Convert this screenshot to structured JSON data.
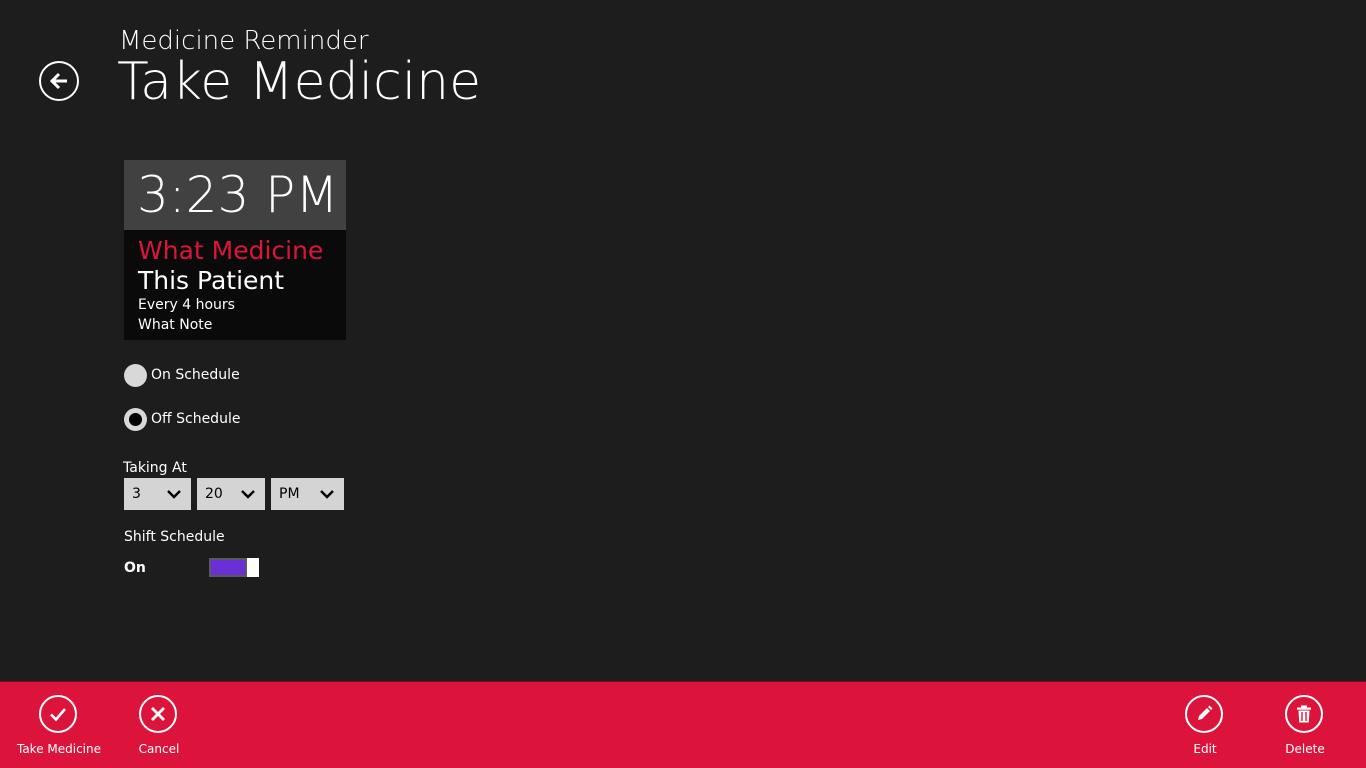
{
  "header": {
    "app_name": "Medicine Reminder",
    "page_title": "Take Medicine",
    "back_icon": "back-arrow-icon"
  },
  "card": {
    "time": "3:23 PM",
    "medicine": "What Medicine",
    "patient": "This Patient",
    "frequency": "Every 4 hours",
    "note": "What Note",
    "medicine_color": "#dc143c"
  },
  "schedule_options": {
    "on_label": "On Schedule",
    "off_label": "Off Schedule",
    "selected": "Off Schedule"
  },
  "taking_at": {
    "label": "Taking At",
    "hour": "3",
    "minute": "20",
    "period": "PM"
  },
  "shift_schedule": {
    "label": "Shift Schedule",
    "state": "On",
    "toggle_color": "#6a2fd6"
  },
  "app_bar": {
    "color": "#dc143c",
    "take_medicine_label": "Take Medicine",
    "cancel_label": "Cancel",
    "edit_label": "Edit",
    "delete_label": "Delete"
  }
}
